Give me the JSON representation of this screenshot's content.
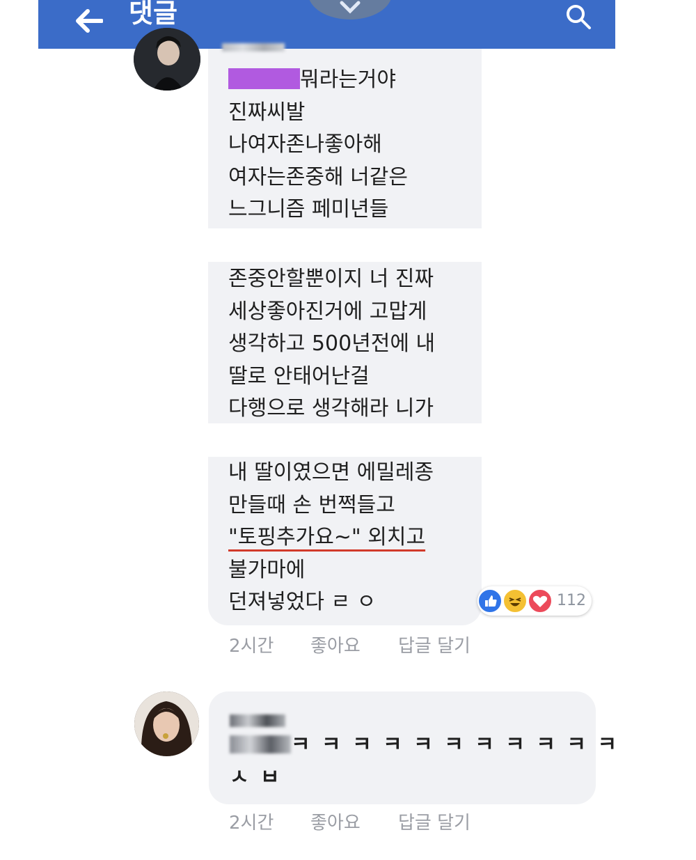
{
  "header": {
    "title": "댓글",
    "back_icon": "arrow-left-icon",
    "close_icon": "close-icon",
    "search_icon": "search-icon",
    "color": "#3b6cc8"
  },
  "comments": [
    {
      "message_blocks": [
        [
          "뭐라는거야",
          "진짜씨발",
          "나여자존나좋아해",
          "여자는존중해 너같은",
          "느그니즘 페미년들"
        ],
        [
          "존중안할뿐이지 너 진짜",
          "세상좋아진거에 고맙게",
          "생각하고 500년전에 내",
          "딸로 안태어난걸",
          "다행으로 생각해라 니가"
        ],
        [
          "내 딸이였으면 에밀레종",
          "만들때 손 번쩍들고",
          "\"토핑추가요~\" 외치고",
          "불가마에",
          "던져넣었다 ㄹ ㅇ"
        ]
      ],
      "reactions": {
        "count": "112",
        "icons": [
          "like-icon",
          "haha-icon",
          "love-icon"
        ]
      },
      "time": "2시간",
      "like_label": "좋아요",
      "reply_label": "답글 달기"
    },
    {
      "text_line1": "ㅋ ㅋ ㅋ ㅋ ㅋ ㅋ ㅋ ㅋ ㅋ ㅋ ㅋ",
      "text_line2": "ㅅ ㅂ",
      "time": "2시간",
      "like_label": "좋아요",
      "reply_label": "답글 달기"
    }
  ]
}
